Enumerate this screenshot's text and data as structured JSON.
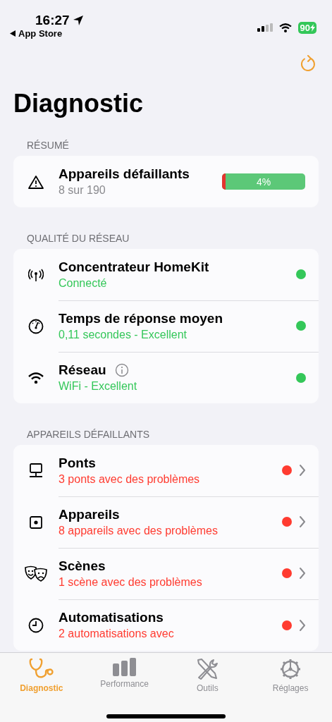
{
  "status_bar": {
    "time": "16:27",
    "back_link": "App Store",
    "battery": "90"
  },
  "title": "Diagnostic",
  "summary": {
    "header": "RÉSUMÉ",
    "title": "Appareils défaillants",
    "subtitle": "8 sur 190",
    "level": 0.04,
    "reading": "4%"
  },
  "network": {
    "header": "QUALITÉ DU RÉSEAU",
    "rows": [
      {
        "title": "Concentrateur HomeKit",
        "subtitle": "Connecté",
        "color": "#34c759",
        "info": false
      },
      {
        "title": "Temps de réponse moyen",
        "subtitle": "0,11 secondes - Excellent",
        "color": "#34c759",
        "info": false
      },
      {
        "title": "Réseau",
        "subtitle": "WiFi - Excellent",
        "color": "#34c759",
        "info": true
      }
    ]
  },
  "failing": {
    "header": "APPAREILS DÉFAILLANTS",
    "rows": [
      {
        "title": "Ponts",
        "subtitle": "3 ponts avec des problèmes",
        "color": "#ff3b30"
      },
      {
        "title": "Appareils",
        "subtitle": "8 appareils avec des problèmes",
        "color": "#ff3b30"
      },
      {
        "title": "Scènes",
        "subtitle": "1 scène avec des problèmes",
        "color": "#ff3b30"
      },
      {
        "title": "Automatisations",
        "subtitle": "2 automatisations avec",
        "color": "#ff3b30"
      }
    ]
  },
  "tabs": [
    {
      "label": "Diagnostic",
      "selected": true
    },
    {
      "label": "Performance",
      "selected": false
    },
    {
      "label": "Outils",
      "selected": false
    },
    {
      "label": "Réglages",
      "selected": false
    }
  ]
}
